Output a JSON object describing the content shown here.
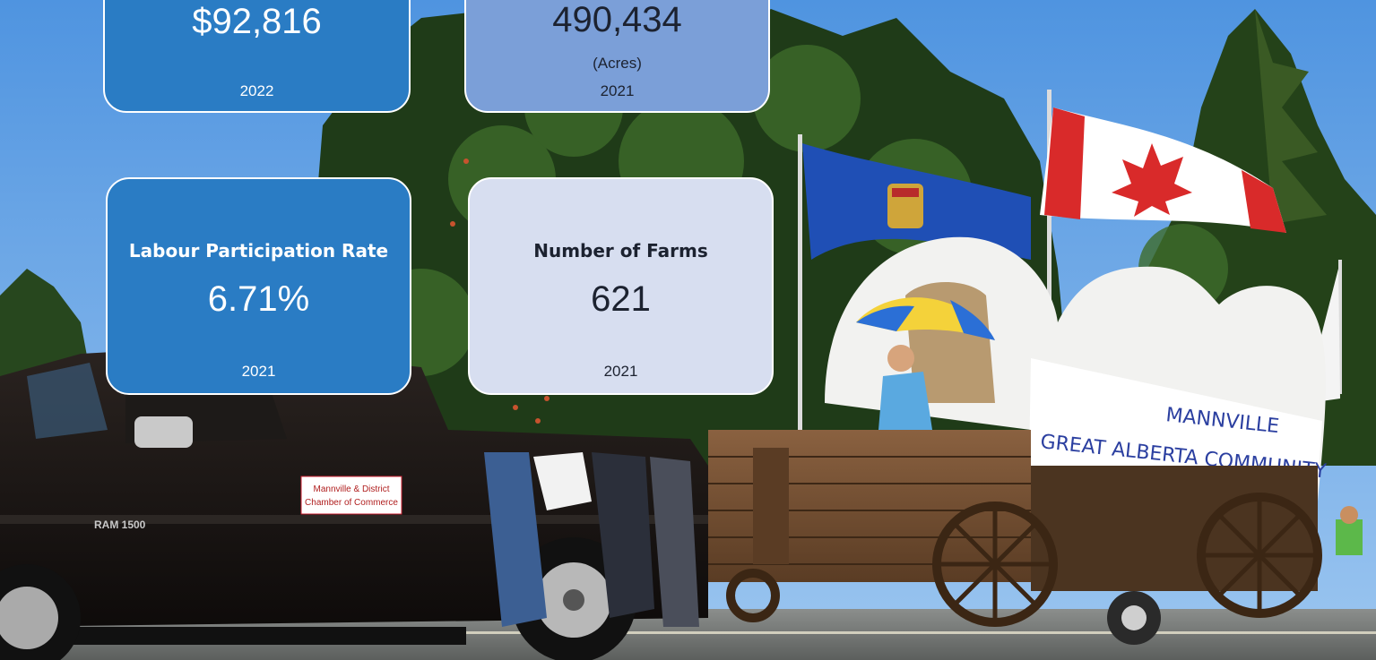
{
  "cards": {
    "income": {
      "value": "$92,816",
      "year": "2022"
    },
    "farmland": {
      "value": "490,434",
      "unit": "(Acres)",
      "year": "2021"
    },
    "labour": {
      "title": "Labour Participation Rate",
      "value": "6.71%",
      "year": "2021"
    },
    "farms": {
      "title": "Number of Farms",
      "value": "621",
      "year": "2021"
    }
  },
  "photo": {
    "sign_truck_line1": "Mannville & District",
    "sign_truck_line2": "Chamber of Commerce",
    "truck_badge": "RAM 1500",
    "banner_line1": "MANNVILLE",
    "banner_line2": "GREAT ALBERTA COMMUNITY"
  },
  "colors": {
    "card_blue": "#2a7cc4",
    "card_periwinkle": "#7b9fd8",
    "card_pale": "#d7def0",
    "sky": "#6aa6e6"
  }
}
